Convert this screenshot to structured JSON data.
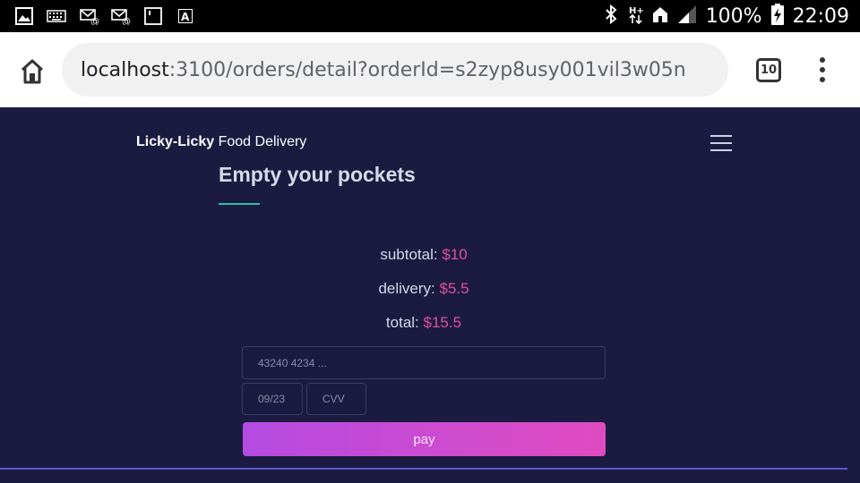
{
  "status_bar": {
    "battery": "100%",
    "time": "22:09",
    "left_icons": [
      "image-icon",
      "keyboard-icon",
      "email-notification-icon",
      "email-notification-icon",
      "sim-card-icon",
      "font-icon"
    ],
    "right_icons": [
      "bluetooth-icon",
      "data-transfer-icon",
      "home-signal-icon",
      "cell-signal-icon",
      "battery-charging-icon"
    ]
  },
  "browser": {
    "url_host": "localhost",
    "url_path": ":3100/orders/detail?orderId=s2zyp8usy001vil3w05n",
    "tab_count": "10"
  },
  "header": {
    "brand_bold": "Licky-Licky",
    "brand_rest": " Food Delivery"
  },
  "main": {
    "title": "Empty your pockets",
    "subtotal_label": "subtotal: ",
    "subtotal_value": "$10",
    "delivery_label": "delivery: ",
    "delivery_value": "$5.5",
    "total_label": "total: ",
    "total_value": "$15.5",
    "card_placeholder": "43240 4234 ...",
    "expiry_placeholder": "09/23",
    "cvv_placeholder": "CVV",
    "pay_label": "pay"
  },
  "colors": {
    "background": "#1b1b42",
    "accent_price": "#e0509a",
    "underline": "#2bbfa9",
    "button_gradient_start": "#b54be3",
    "button_gradient_end": "#e04bc0"
  }
}
